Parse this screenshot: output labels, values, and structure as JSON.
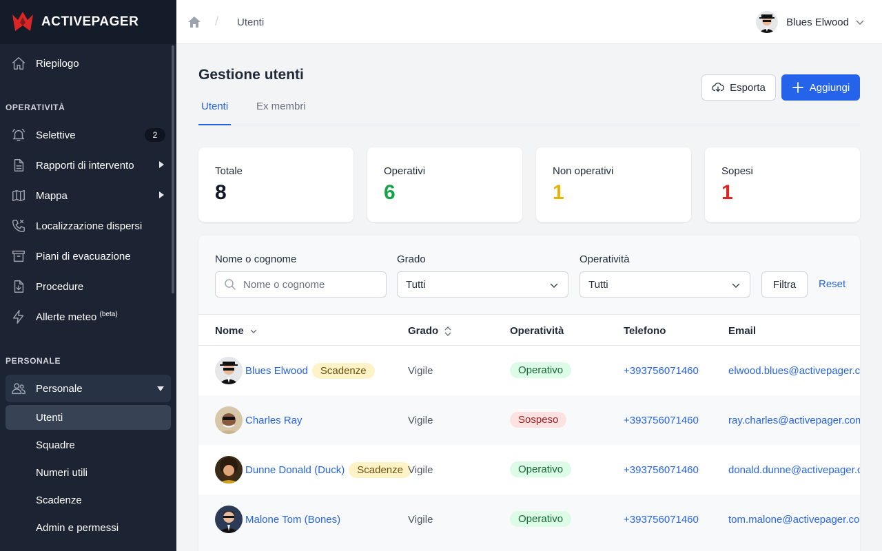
{
  "brand": {
    "name": "ACTIVEPAGER",
    "color": "#dc2626"
  },
  "sidebar": {
    "top_item": {
      "label": "Riepilogo",
      "icon": "home-icon"
    },
    "section_operativita": "OPERATIVITÀ",
    "operativita_items": [
      {
        "label": "Selettive",
        "icon": "bell-icon",
        "badge": "2"
      },
      {
        "label": "Rapporti di intervento",
        "icon": "document-icon"
      },
      {
        "label": "Mappa",
        "icon": "map-icon"
      },
      {
        "label": "Localizzazione dispersi",
        "icon": "phone-call-icon"
      },
      {
        "label": "Piani di evacuazione",
        "icon": "archive-icon"
      },
      {
        "label": "Procedure",
        "icon": "document-download-icon"
      },
      {
        "label": "Allerte meteo",
        "sup": "(beta)",
        "icon": "lightning-icon"
      }
    ],
    "section_personale": "PERSONALE",
    "personale_group": {
      "label": "Personale",
      "icon": "users-icon"
    },
    "personale_sub": [
      "Utenti",
      "Squadre",
      "Numeri utili",
      "Scadenze",
      "Admin e permessi"
    ]
  },
  "topbar": {
    "breadcrumb_sep": "/",
    "breadcrumb_current": "Utenti",
    "user_name": "Blues Elwood"
  },
  "page": {
    "title": "Gestione utenti",
    "export_label": "Esporta",
    "add_label": "Aggiungi",
    "tabs": [
      "Utenti",
      "Ex membri"
    ]
  },
  "stats": [
    {
      "label": "Totale",
      "value": "8",
      "color": "#111827"
    },
    {
      "label": "Operativi",
      "value": "6",
      "color": "#16a34a"
    },
    {
      "label": "Non operativi",
      "value": "1",
      "color": "#eab308"
    },
    {
      "label": "Sopesi",
      "value": "1",
      "color": "#dc2626"
    }
  ],
  "filters": {
    "name_label": "Nome o cognome",
    "name_placeholder": "Nome o cognome",
    "grade_label": "Grado",
    "grade_value": "Tutti",
    "op_label": "Operatività",
    "op_value": "Tutti",
    "filter_button": "Filtra",
    "reset_button": "Reset"
  },
  "table": {
    "headers": [
      "Nome",
      "Grado",
      "Operatività",
      "Telefono",
      "Email"
    ],
    "rows": [
      {
        "name": "Blues Elwood",
        "tag": "Scadenze",
        "grade": "Vigile",
        "status": "Operativo",
        "status_kind": "ok",
        "phone": "+393756071460",
        "email": "elwood.blues@activepager.com"
      },
      {
        "name": "Charles Ray",
        "tag": "",
        "grade": "Vigile",
        "status": "Sospeso",
        "status_kind": "bad",
        "phone": "+393756071460",
        "email": "ray.charles@activepager.com"
      },
      {
        "name": "Dunne Donald (Duck)",
        "tag": "Scadenze",
        "grade": "Vigile",
        "status": "Operativo",
        "status_kind": "ok",
        "phone": "+393756071460",
        "email": "donald.dunne@activepager.com"
      },
      {
        "name": "Malone Tom (Bones)",
        "tag": "",
        "grade": "Vigile",
        "status": "Operativo",
        "status_kind": "ok",
        "phone": "+393756071460",
        "email": "tom.malone@activepager.com"
      }
    ]
  },
  "colors": {
    "primary": "#2563eb",
    "sidebar_bg": "#1c2434",
    "brand_bg": "#141b29"
  }
}
